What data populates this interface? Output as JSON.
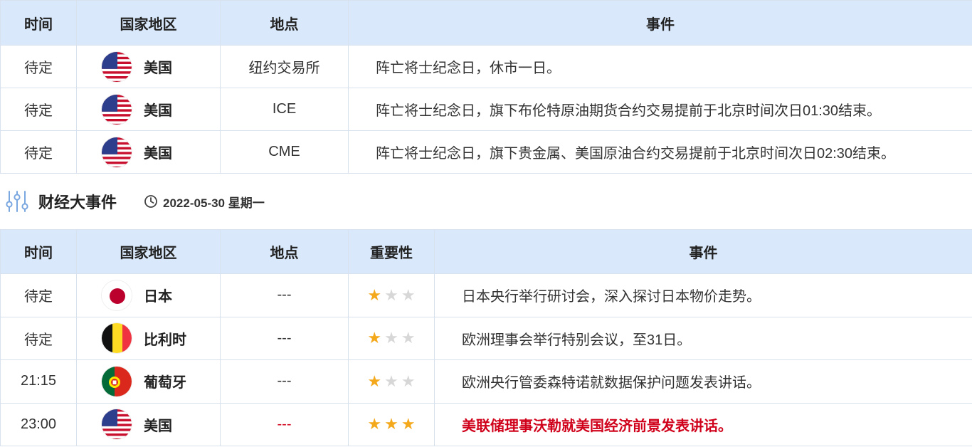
{
  "top_table": {
    "headers": {
      "time": "时间",
      "country": "国家地区",
      "place": "地点",
      "event": "事件"
    },
    "rows": [
      {
        "time": "待定",
        "country": "美国",
        "flag": "us-flag-icon",
        "place": "纽约交易所",
        "event": "阵亡将士纪念日，休市一日。"
      },
      {
        "time": "待定",
        "country": "美国",
        "flag": "us-flag-icon",
        "place": "ICE",
        "event": "阵亡将士纪念日，旗下布伦特原油期货合约交易提前于北京时间次日01:30结束。"
      },
      {
        "time": "待定",
        "country": "美国",
        "flag": "us-flag-icon",
        "place": "CME",
        "event": "阵亡将士纪念日，旗下贵金属、美国原油合约交易提前于北京时间次日02:30结束。"
      }
    ]
  },
  "section": {
    "icon": "sliders-icon",
    "title": "财经大事件",
    "clock_icon": "clock-icon",
    "date": "2022-05-30 星期一"
  },
  "bottom_table": {
    "headers": {
      "time": "时间",
      "country": "国家地区",
      "place": "地点",
      "importance": "重要性",
      "event": "事件"
    },
    "rows": [
      {
        "time": "待定",
        "country": "日本",
        "flag": "japan-flag-icon",
        "place": "---",
        "importance": 1,
        "event": "日本央行举行研讨会，深入探讨日本物价走势。",
        "highlight": false
      },
      {
        "time": "待定",
        "country": "比利时",
        "flag": "belgium-flag-icon",
        "place": "---",
        "importance": 1,
        "event": "欧洲理事会举行特别会议，至31日。",
        "highlight": false
      },
      {
        "time": "21:15",
        "country": "葡萄牙",
        "flag": "portugal-flag-icon",
        "place": "---",
        "importance": 1,
        "event": "欧洲央行管委森特诺就数据保护问题发表讲话。",
        "highlight": false
      },
      {
        "time": "23:00",
        "country": "美国",
        "flag": "us-flag-icon",
        "place": "---",
        "importance": 3,
        "event": "美联储理事沃勒就美国经济前景发表讲话。",
        "highlight": true
      }
    ]
  },
  "colors": {
    "header_bg": "#d9e8fb",
    "border": "#d8e1ee",
    "star_on": "#f4a81c",
    "star_off": "#d7d7d7",
    "highlight": "#d0021b"
  }
}
